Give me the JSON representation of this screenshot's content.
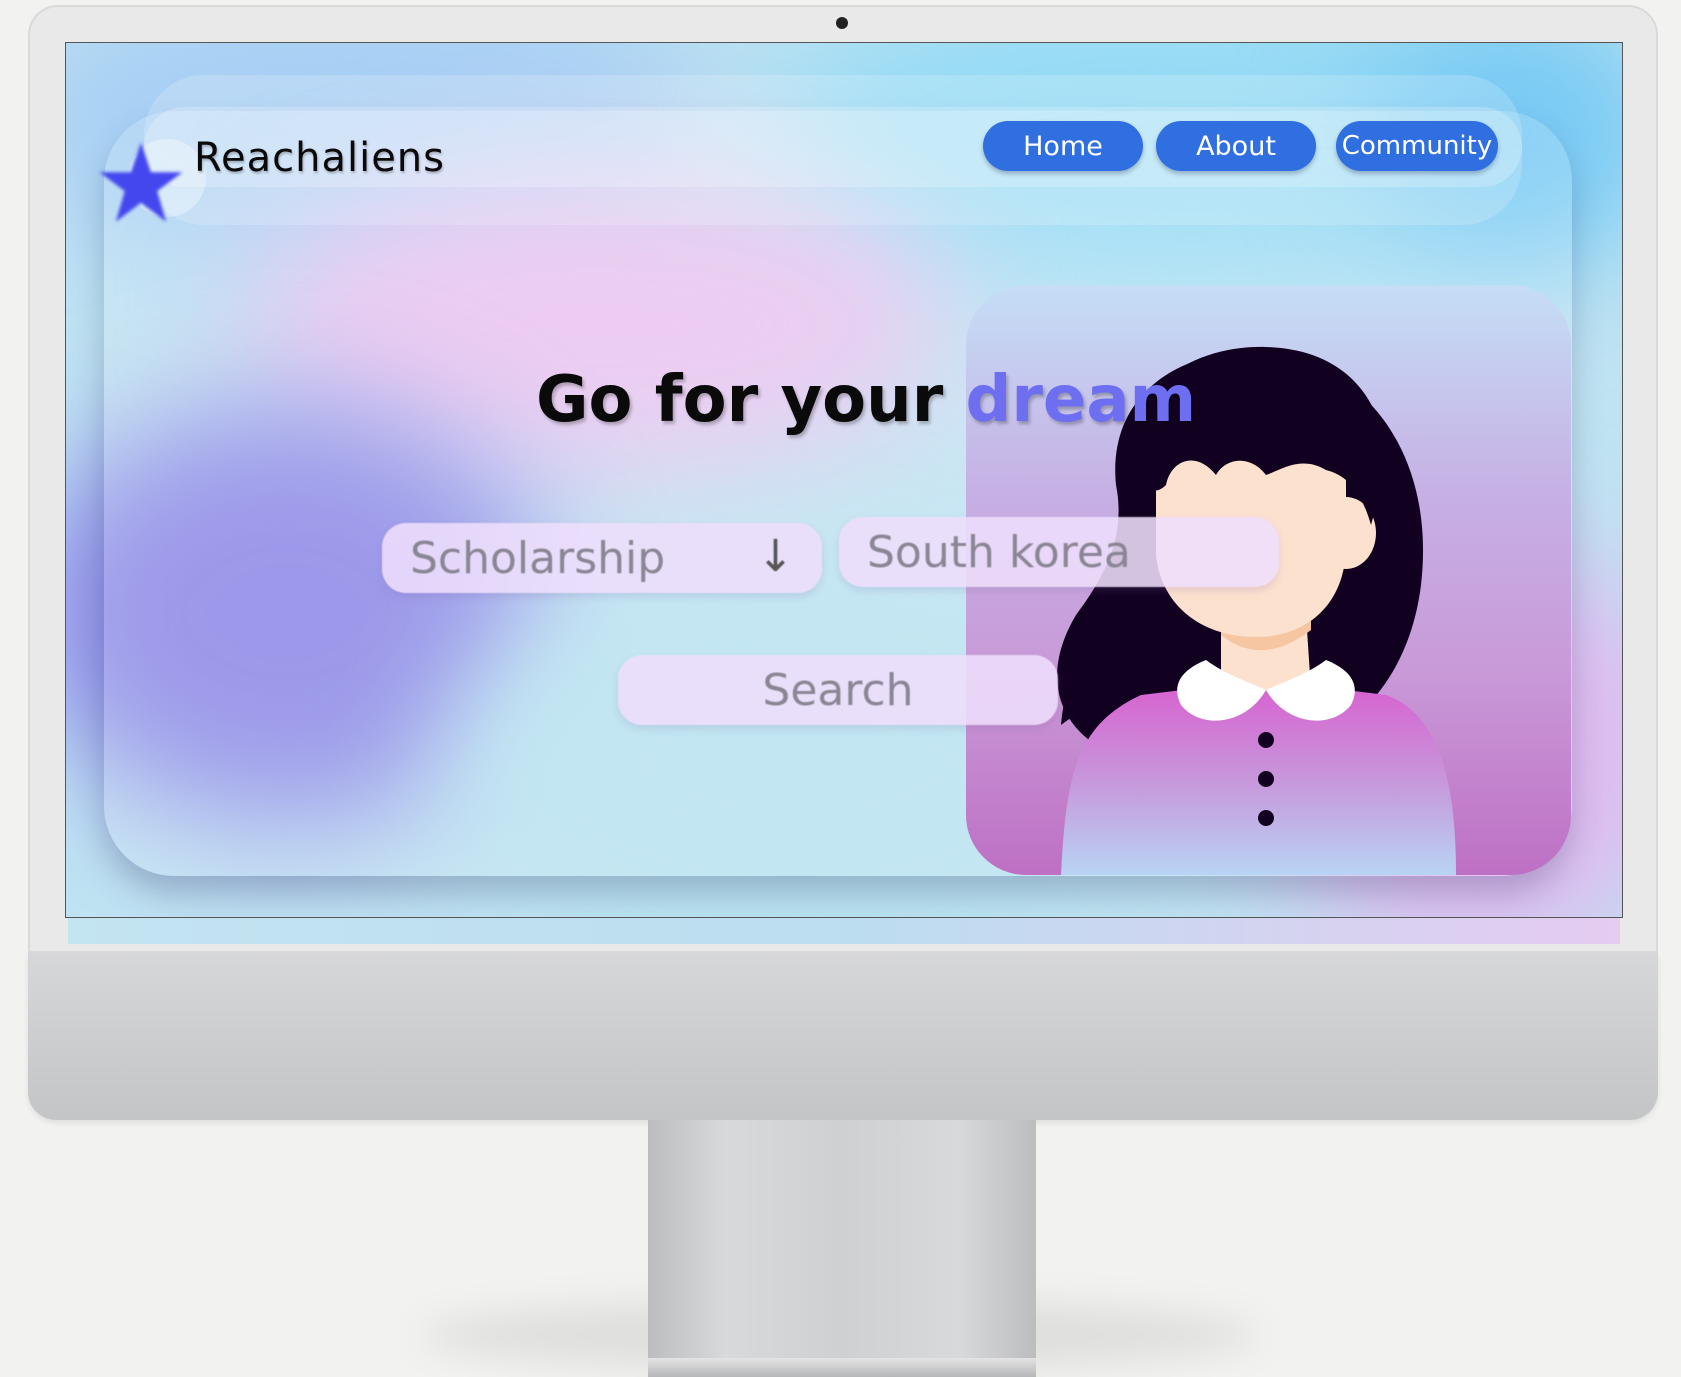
{
  "app": {
    "brand": "Reachaliens",
    "nav": [
      {
        "label": "Home"
      },
      {
        "label": "About"
      },
      {
        "label": "Community"
      }
    ]
  },
  "hero": {
    "title_main": "Go for your",
    "title_accent": "dream"
  },
  "search": {
    "category_value": "Scholarship",
    "category_arrow": "↓",
    "country_value": "South korea",
    "search_label": "Search"
  },
  "colors": {
    "accent": "#6d6ef0",
    "nav_button": "#2f6fe0",
    "star": "#4447ee"
  },
  "icons": {
    "logo": "star-icon",
    "dropdown": "arrow-down-icon"
  }
}
